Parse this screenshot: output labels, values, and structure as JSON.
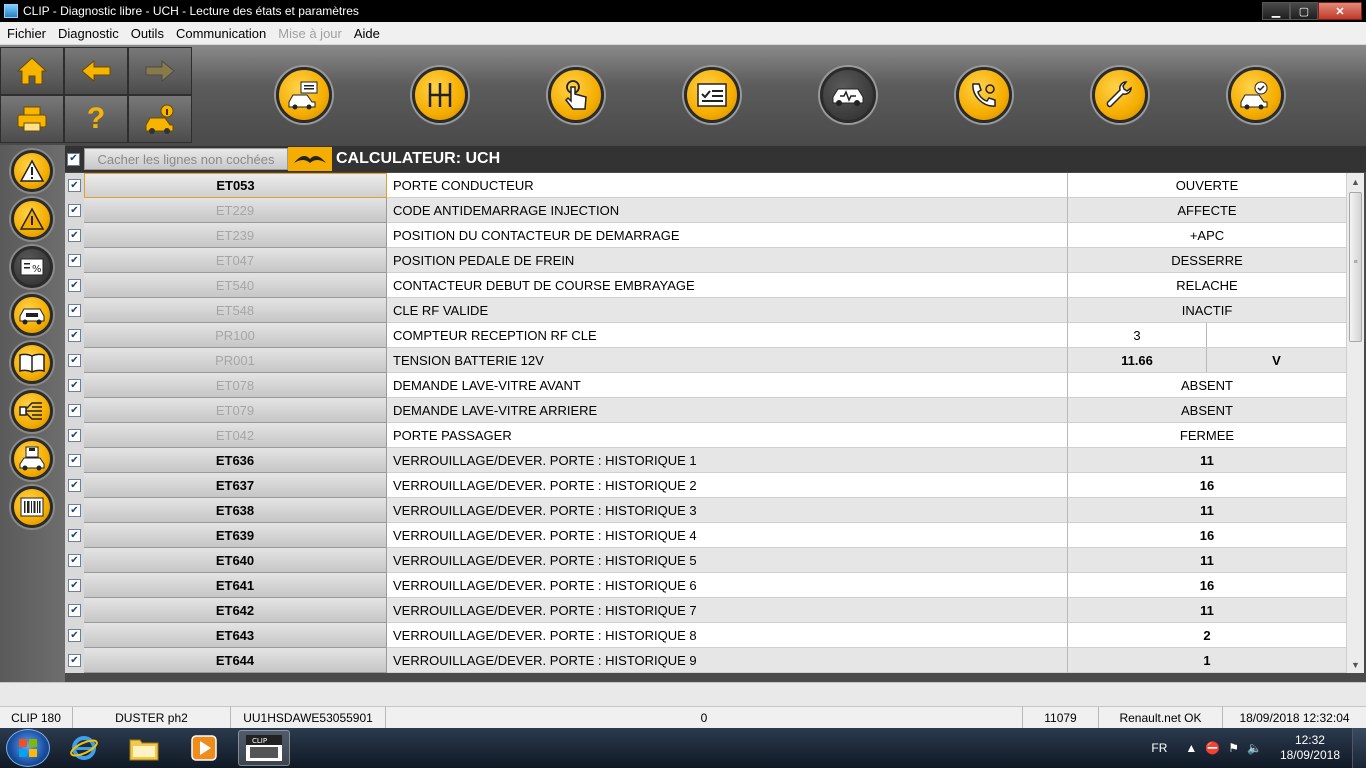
{
  "window": {
    "title": "CLIP - Diagnostic libre - UCH - Lecture des états et paramètres",
    "minimize": "▁",
    "maximize": "▢",
    "close": "✕"
  },
  "menu": [
    {
      "label": "Fichier",
      "disabled": false
    },
    {
      "label": "Diagnostic",
      "disabled": false
    },
    {
      "label": "Outils",
      "disabled": false
    },
    {
      "label": "Communication",
      "disabled": false
    },
    {
      "label": "Mise à jour",
      "disabled": true
    },
    {
      "label": "Aide",
      "disabled": false
    }
  ],
  "toolbar": {
    "help_label": "?",
    "icons": [
      "car-display-icon",
      "gearbox-icon",
      "touch-icon",
      "checklist-icon",
      "diagnostic-car-icon",
      "phone-support-icon",
      "wrench-icon",
      "car-check-icon"
    ]
  },
  "sidebar_icons": [
    "warning-icon",
    "alert-icon",
    "params-percent-icon",
    "car-ecu-icon",
    "book-icon",
    "wiring-icon",
    "save-car-icon",
    "barcode-icon"
  ],
  "content": {
    "hide_unchecked_label": "Cacher les lignes non cochées",
    "calc_title": "CALCULATEUR: UCH"
  },
  "rows": [
    {
      "code": "ET053",
      "label": "PORTE CONDUCTEUR",
      "value": "OUVERTE",
      "unit": "",
      "active": true
    },
    {
      "code": "ET229",
      "label": "CODE ANTIDEMARRAGE INJECTION",
      "value": "AFFECTE",
      "unit": "",
      "active": false
    },
    {
      "code": "ET239",
      "label": "POSITION DU CONTACTEUR DE DEMARRAGE",
      "value": "+APC",
      "unit": "",
      "active": false
    },
    {
      "code": "ET047",
      "label": "POSITION PEDALE DE FREIN",
      "value": "DESSERRE",
      "unit": "",
      "active": false
    },
    {
      "code": "ET540",
      "label": "CONTACTEUR DEBUT DE COURSE EMBRAYAGE",
      "value": "RELACHE",
      "unit": "",
      "active": false
    },
    {
      "code": "ET548",
      "label": "CLE RF VALIDE",
      "value": "INACTIF",
      "unit": "",
      "active": false
    },
    {
      "code": "PR100",
      "label": "COMPTEUR RECEPTION RF CLE",
      "value": "3",
      "unit": "",
      "active": false,
      "split": true
    },
    {
      "code": "PR001",
      "label": "TENSION BATTERIE 12V",
      "value": "11.66",
      "unit": "V",
      "active": false,
      "split": true
    },
    {
      "code": "ET078",
      "label": "DEMANDE LAVE-VITRE AVANT",
      "value": "ABSENT",
      "unit": "",
      "active": false
    },
    {
      "code": "ET079",
      "label": "DEMANDE LAVE-VITRE ARRIERE",
      "value": "ABSENT",
      "unit": "",
      "active": false
    },
    {
      "code": "ET042",
      "label": "PORTE PASSAGER",
      "value": "FERMEE",
      "unit": "",
      "active": false
    },
    {
      "code": "ET636",
      "label": "VERROUILLAGE/DEVER. PORTE : HISTORIQUE 1",
      "value": "11",
      "unit": "",
      "active": true
    },
    {
      "code": "ET637",
      "label": "VERROUILLAGE/DEVER. PORTE : HISTORIQUE 2",
      "value": "16",
      "unit": "",
      "active": true
    },
    {
      "code": "ET638",
      "label": "VERROUILLAGE/DEVER. PORTE : HISTORIQUE 3",
      "value": "11",
      "unit": "",
      "active": true
    },
    {
      "code": "ET639",
      "label": "VERROUILLAGE/DEVER. PORTE : HISTORIQUE 4",
      "value": "16",
      "unit": "",
      "active": true
    },
    {
      "code": "ET640",
      "label": "VERROUILLAGE/DEVER. PORTE : HISTORIQUE 5",
      "value": "11",
      "unit": "",
      "active": true
    },
    {
      "code": "ET641",
      "label": "VERROUILLAGE/DEVER. PORTE : HISTORIQUE 6",
      "value": "16",
      "unit": "",
      "active": true
    },
    {
      "code": "ET642",
      "label": "VERROUILLAGE/DEVER. PORTE : HISTORIQUE 7",
      "value": "11",
      "unit": "",
      "active": true
    },
    {
      "code": "ET643",
      "label": "VERROUILLAGE/DEVER. PORTE : HISTORIQUE 8",
      "value": "2",
      "unit": "",
      "active": true
    },
    {
      "code": "ET644",
      "label": "VERROUILLAGE/DEVER. PORTE : HISTORIQUE 9",
      "value": "1",
      "unit": "",
      "active": true
    }
  ],
  "status": {
    "tool": "CLIP 180",
    "vehicle": "DUSTER ph2",
    "vin": "UU1HSDAWE53055901",
    "counter": "0",
    "version": "11079",
    "connection": "Renault.net OK",
    "datetime": "18/09/2018 12:32:04"
  },
  "taskbar": {
    "lang": "FR",
    "time": "12:32",
    "date": "18/09/2018",
    "clip_label": "CLIP"
  },
  "colors": {
    "accent": "#f5ad00",
    "toolbar": "#5c5c5c"
  }
}
